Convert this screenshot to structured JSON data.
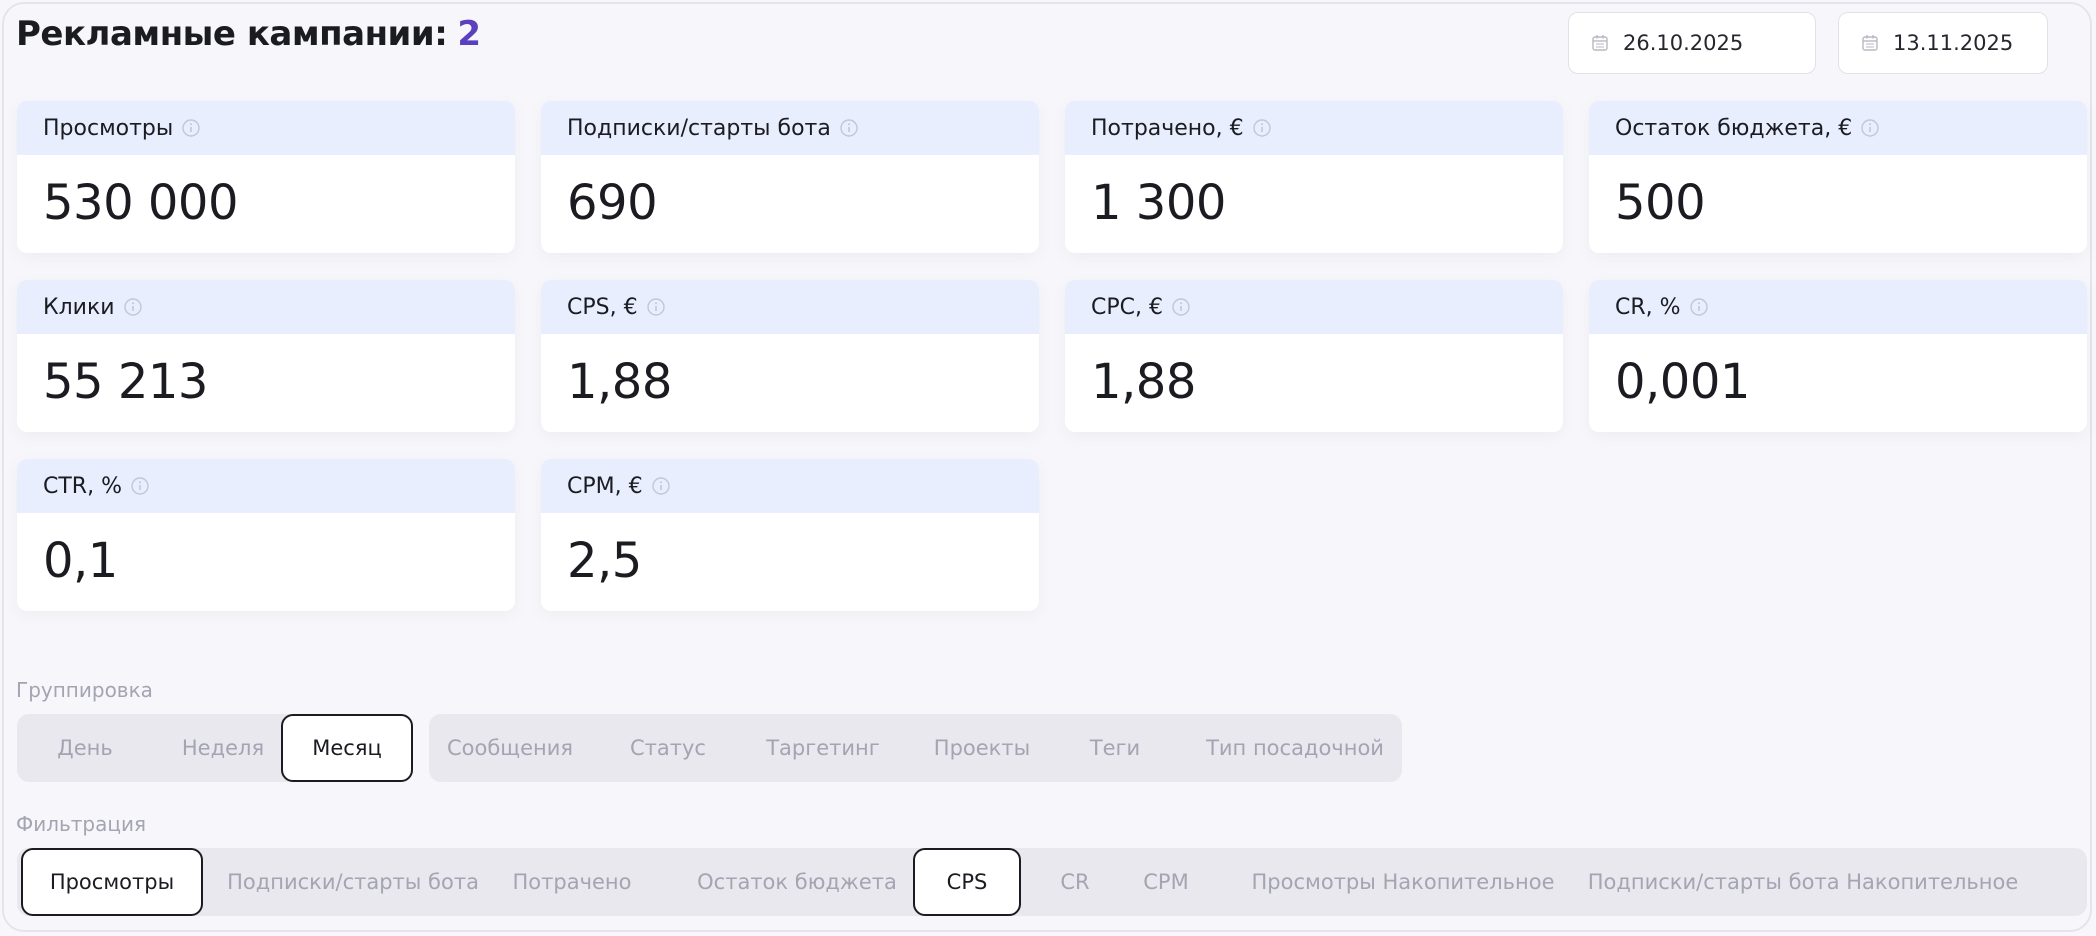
{
  "header": {
    "title": "Рекламные кампании:",
    "count": "2"
  },
  "dates": {
    "from": "26.10.2025",
    "to": "13.11.2025",
    "icon": "calendar-icon"
  },
  "metrics": [
    {
      "label": "Просмотры",
      "value": "530 000"
    },
    {
      "label": "Подписки/старты бота",
      "value": "690"
    },
    {
      "label": "Потрачено, €",
      "value": "1 300"
    },
    {
      "label": "Остаток бюджета, €",
      "value": "500"
    },
    {
      "label": "Клики",
      "value": "55 213"
    },
    {
      "label": "CPS, €",
      "value": "1,88"
    },
    {
      "label": "CPC, €",
      "value": "1,88"
    },
    {
      "label": "CR, %",
      "value": "0,001"
    },
    {
      "label": "CTR, %",
      "value": "0,1"
    },
    {
      "label": "CPM, €",
      "value": "2,5"
    }
  ],
  "grouping": {
    "label": "Группировка",
    "period": [
      "День",
      "Неделя",
      "Месяц"
    ],
    "period_active": "Месяц",
    "dimensions": [
      "Сообщения",
      "Статус",
      "Таргетинг",
      "Проекты",
      "Теги",
      "Тип посадочной"
    ]
  },
  "filtering": {
    "label": "Фильтрация",
    "options": [
      "Просмотры",
      "Подписки/старты бота",
      "Потрачено",
      "Остаток бюджета",
      "CPS",
      "CR",
      "CPM",
      "Просмотры Накопительное",
      "Подписки/старты бота Накопительное"
    ],
    "active": [
      "Просмотры",
      "CPS"
    ]
  },
  "colors": {
    "accent": "#5b3fbf",
    "card_header": "#e8eefd",
    "segment_bg": "#e8e8ee"
  }
}
